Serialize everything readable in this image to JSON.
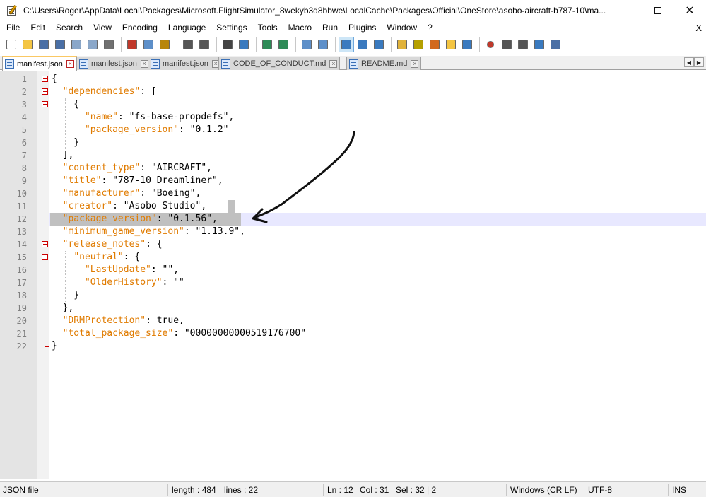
{
  "window": {
    "title": "C:\\Users\\Roger\\AppData\\Local\\Packages\\Microsoft.FlightSimulator_8wekyb3d8bbwe\\LocalCache\\Packages\\Official\\OneStore\\asobo-aircraft-b787-10\\ma...",
    "close_glyph": "✕"
  },
  "menu": {
    "items": [
      "File",
      "Edit",
      "Search",
      "View",
      "Encoding",
      "Language",
      "Settings",
      "Tools",
      "Macro",
      "Run",
      "Plugins",
      "Window",
      "?"
    ],
    "close": "X"
  },
  "toolbar": {
    "buttons": [
      {
        "name": "new-file",
        "color": "#ffffff"
      },
      {
        "name": "open-file",
        "color": "#f4c542"
      },
      {
        "name": "save",
        "color": "#4a6fa5"
      },
      {
        "name": "save-all",
        "color": "#4a6fa5"
      },
      {
        "name": "close",
        "color": "#8aa7c9"
      },
      {
        "name": "close-all",
        "color": "#8aa7c9"
      },
      {
        "name": "print",
        "color": "#707070"
      },
      {
        "name": "cut",
        "color": "#c0392b"
      },
      {
        "name": "copy",
        "color": "#5d8fc9"
      },
      {
        "name": "paste",
        "color": "#b8860b"
      },
      {
        "name": "undo",
        "color": "#555555"
      },
      {
        "name": "redo",
        "color": "#555555"
      },
      {
        "name": "find",
        "color": "#444444"
      },
      {
        "name": "replace",
        "color": "#3a7abf"
      },
      {
        "name": "zoom-in",
        "color": "#2e8b57"
      },
      {
        "name": "zoom-out",
        "color": "#2e8b57"
      },
      {
        "name": "sync-vertical",
        "color": "#5d8fc9"
      },
      {
        "name": "sync-horizontal",
        "color": "#5d8fc9"
      },
      {
        "name": "word-wrap",
        "color": "#3a7abf"
      },
      {
        "name": "show-all-chars",
        "color": "#3a7abf"
      },
      {
        "name": "indent-guide",
        "color": "#3a7abf"
      },
      {
        "name": "udl",
        "color": "#e0b23a"
      },
      {
        "name": "doc-map",
        "color": "#b5a000"
      },
      {
        "name": "function-list",
        "color": "#d2691e"
      },
      {
        "name": "folder-as-workspace",
        "color": "#f4c542"
      },
      {
        "name": "monitoring",
        "color": "#3a7abf"
      },
      {
        "name": "record-macro",
        "color": "#c0392b"
      },
      {
        "name": "stop-macro",
        "color": "#555555"
      },
      {
        "name": "play-macro",
        "color": "#555555"
      },
      {
        "name": "play-macro-multiple",
        "color": "#3a7abf"
      },
      {
        "name": "save-macro",
        "color": "#4a6fa5"
      }
    ]
  },
  "tabs": [
    {
      "label": "manifest.json",
      "active": true
    },
    {
      "label": "manifest.json",
      "active": false
    },
    {
      "label": "manifest.json",
      "active": false
    },
    {
      "label": "CODE_OF_CONDUCT.md",
      "active": false
    },
    {
      "label": "README.md",
      "active": false
    }
  ],
  "tab_scroll": {
    "left": "◀",
    "right": "▶"
  },
  "editor": {
    "lines": [
      [
        [
          "p",
          "{"
        ]
      ],
      [
        [
          "p",
          "  "
        ],
        [
          "k",
          "\"dependencies\""
        ],
        [
          "p",
          ": ["
        ]
      ],
      [
        [
          "p",
          "    {"
        ]
      ],
      [
        [
          "p",
          "      "
        ],
        [
          "k",
          "\"name\""
        ],
        [
          "p",
          ": \"fs-base-propdefs\","
        ]
      ],
      [
        [
          "p",
          "      "
        ],
        [
          "k",
          "\"package_version\""
        ],
        [
          "p",
          ": \"0.1.2\""
        ]
      ],
      [
        [
          "p",
          "    }"
        ]
      ],
      [
        [
          "p",
          "  ],"
        ]
      ],
      [
        [
          "p",
          "  "
        ],
        [
          "k",
          "\"content_type\""
        ],
        [
          "p",
          ": \"AIRCRAFT\","
        ]
      ],
      [
        [
          "p",
          "  "
        ],
        [
          "k",
          "\"title\""
        ],
        [
          "p",
          ": \"787-10 Dreamliner\","
        ]
      ],
      [
        [
          "p",
          "  "
        ],
        [
          "k",
          "\"manufacturer\""
        ],
        [
          "p",
          ": \"Boeing\","
        ]
      ],
      [
        [
          "p",
          "  "
        ],
        [
          "k",
          "\"creator\""
        ],
        [
          "p",
          ": \"Asobo Studio\","
        ]
      ],
      [
        [
          "p",
          "  "
        ],
        [
          "k",
          "\"package_version\""
        ],
        [
          "p",
          ": \"0.1.56\","
        ]
      ],
      [
        [
          "p",
          "  "
        ],
        [
          "k",
          "\"minimum_game_version\""
        ],
        [
          "p",
          ": \"1.13.9\","
        ]
      ],
      [
        [
          "p",
          "  "
        ],
        [
          "k",
          "\"release_notes\""
        ],
        [
          "p",
          ": {"
        ]
      ],
      [
        [
          "p",
          "    "
        ],
        [
          "k",
          "\"neutral\""
        ],
        [
          "p",
          ": {"
        ]
      ],
      [
        [
          "p",
          "      "
        ],
        [
          "k",
          "\"LastUpdate\""
        ],
        [
          "p",
          ": \"\","
        ]
      ],
      [
        [
          "p",
          "      "
        ],
        [
          "k",
          "\"OlderHistory\""
        ],
        [
          "p",
          ": \"\""
        ]
      ],
      [
        [
          "p",
          "    }"
        ]
      ],
      [
        [
          "p",
          "  },"
        ]
      ],
      [
        [
          "p",
          "  "
        ],
        [
          "k",
          "\"DRMProtection\""
        ],
        [
          "p",
          ": true,"
        ]
      ],
      [
        [
          "p",
          "  "
        ],
        [
          "k",
          "\"total_package_size\""
        ],
        [
          "p",
          ": \"00000000000519176700\""
        ]
      ],
      [
        [
          "p",
          "}"
        ]
      ]
    ],
    "current_line": 12
  },
  "status": {
    "file_type": "JSON file",
    "length": "length : 484",
    "lines": "lines : 22",
    "ln": "Ln : 12",
    "col": "Col : 31",
    "sel": "Sel : 32 | 2",
    "eol": "Windows (CR LF)",
    "encoding": "UTF-8",
    "mode": "INS"
  }
}
